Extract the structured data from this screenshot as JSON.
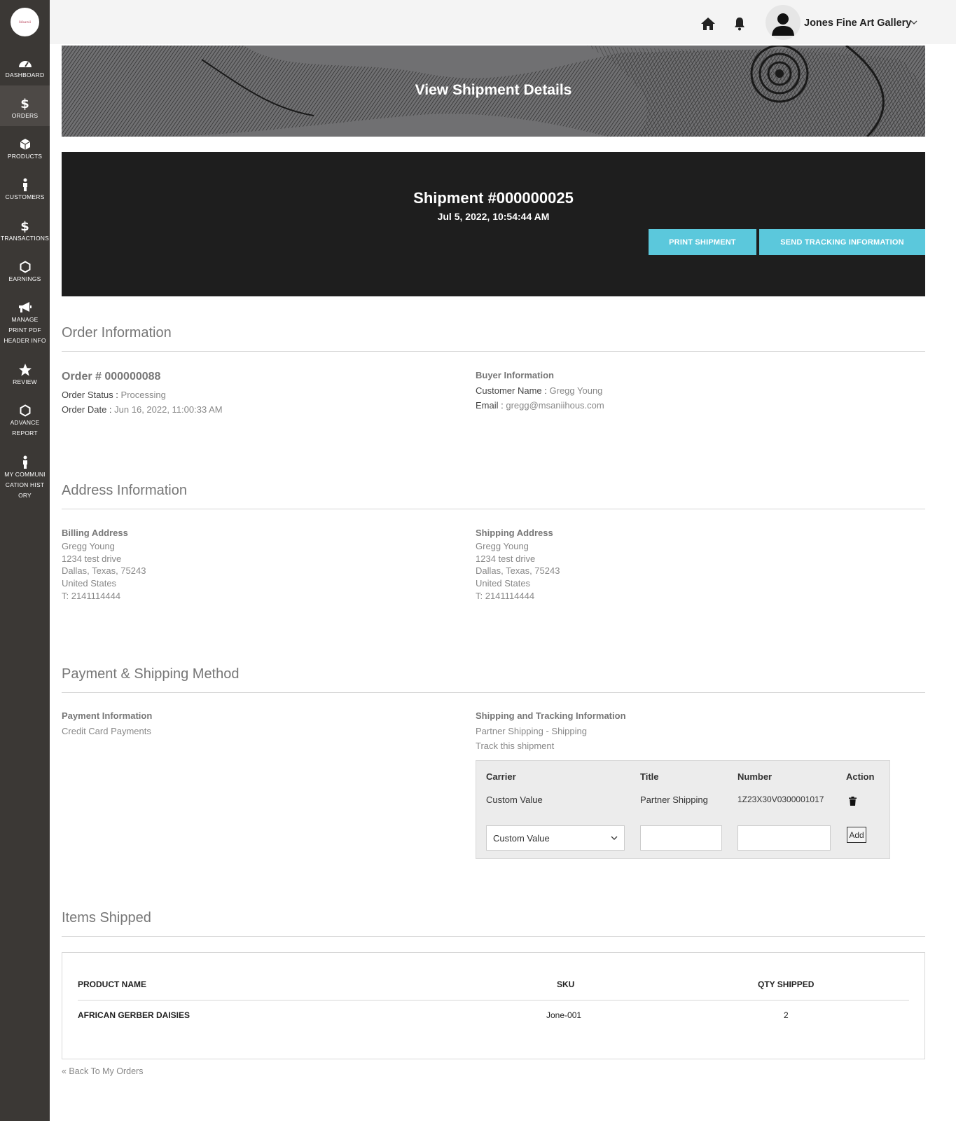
{
  "app": {
    "logo_text": "Msanii"
  },
  "sidebar": {
    "items": [
      {
        "label": "DASHBOARD",
        "icon": "dashboard-icon"
      },
      {
        "label": "ORDERS",
        "icon": "dollar-icon"
      },
      {
        "label": "PRODUCTS",
        "icon": "box-icon"
      },
      {
        "label": "CUSTOMERS",
        "icon": "person-icon"
      },
      {
        "label": "TRANSACTIONS",
        "icon": "dollar-icon"
      },
      {
        "label": "EARNINGS",
        "icon": "hexagon-icon"
      },
      {
        "label": "MANAGE PRINT PDF HEADER INFO",
        "icon": "megaphone-icon"
      },
      {
        "label": "REVIEW",
        "icon": "star-icon"
      },
      {
        "label": "ADVANCE REPORT",
        "icon": "hexagon-icon"
      },
      {
        "label": "MY COMMUNICATION HISTORY",
        "icon": "person-icon"
      }
    ]
  },
  "topbar": {
    "user_name": "Jones Fine Art Gallery"
  },
  "banner": {
    "title": "View Shipment Details"
  },
  "shipment": {
    "title": "Shipment #000000025",
    "date": "Jul 5, 2022, 10:54:44 AM",
    "print_button": "PRINT SHIPMENT",
    "tracking_button": "SEND TRACKING INFORMATION"
  },
  "order_info": {
    "heading": "Order Information",
    "order_number": "Order # 000000088",
    "status_label": "Order Status :",
    "status_value": "Processing",
    "date_label": "Order Date :",
    "date_value": "Jun 16, 2022, 11:00:33 AM",
    "buyer_heading": "Buyer Information",
    "customer_label": "Customer Name :",
    "customer_value": "Gregg Young",
    "email_label": "Email :",
    "email_value": "gregg@msaniihous.com"
  },
  "address_info": {
    "heading": "Address Information",
    "billing": {
      "heading": "Billing Address",
      "lines": [
        "Gregg Young",
        "1234 test drive",
        "Dallas, Texas, 75243",
        "United States",
        "T: 2141114444"
      ]
    },
    "shipping": {
      "heading": "Shipping Address",
      "lines": [
        "Gregg Young",
        "1234 test drive",
        "Dallas, Texas, 75243",
        "United States",
        "T: 2141114444"
      ]
    }
  },
  "payment_info": {
    "heading": "Payment & Shipping Method",
    "payment_heading": "Payment Information",
    "payment_value": "Credit Card Payments",
    "shipping_heading": "Shipping and Tracking Information",
    "shipping_method": "Partner Shipping - Shipping",
    "track_link": "Track this shipment",
    "tracking_table": {
      "headers": [
        "Carrier",
        "Title",
        "Number",
        "Action"
      ],
      "row": {
        "carrier": "Custom Value",
        "title": "Partner Shipping",
        "number": "1Z23X30V0300001017"
      },
      "select_value": "Custom Value",
      "add_button": "Add"
    }
  },
  "items_shipped": {
    "heading": "Items Shipped",
    "headers": [
      "PRODUCT NAME",
      "SKU",
      "QTY SHIPPED"
    ],
    "rows": [
      {
        "name": "AFRICAN GERBER DAISIES",
        "sku": "Jone-001",
        "qty": "2"
      }
    ]
  },
  "back_link": "« Back To My Orders"
}
